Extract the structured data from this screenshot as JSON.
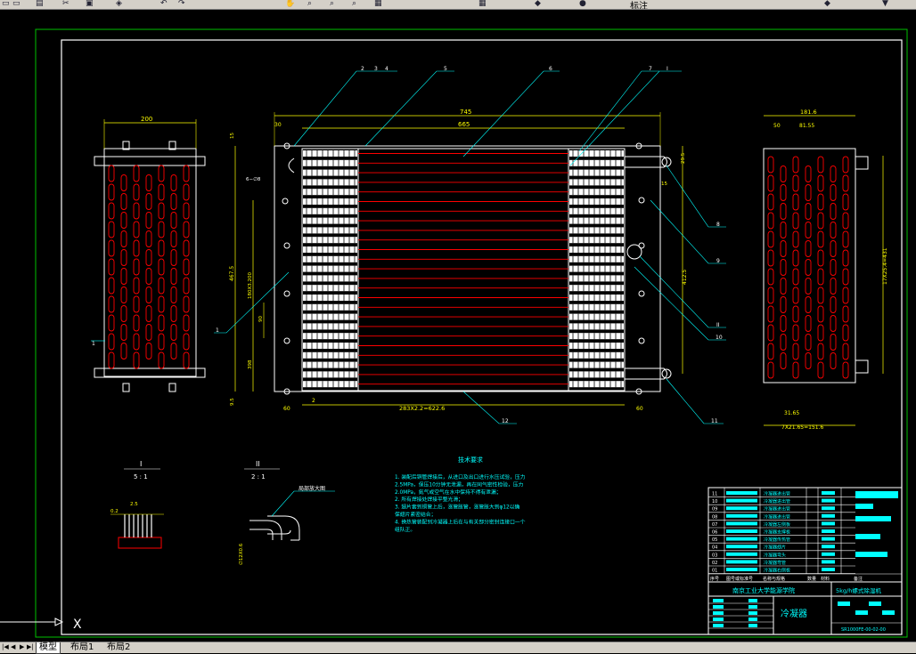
{
  "toolbar": {
    "layer_name": "标注"
  },
  "drawing": {
    "part_labels": [
      "2",
      "3",
      "4",
      "5",
      "6",
      "7",
      "I",
      "8",
      "9",
      "II",
      "10",
      "11",
      "12",
      "1",
      "1"
    ],
    "dims": {
      "left_width": "200",
      "overall_length": "745",
      "tube_length": "665",
      "top_offset": "30",
      "right_width": "181.6",
      "right_sub_a": "50",
      "right_sub_b": "81.55",
      "left_height": "467.5",
      "pitch_note": "180X3.200",
      "dim_90": "90",
      "dim_398": "398",
      "dim_60_left": "60",
      "dim_2": "2",
      "dim_60_right": "60",
      "bottom_span": "283X2.2=622.6",
      "right_height_a": "412.5",
      "right_vert": "17X25.4=431",
      "right_side_a": "29.5",
      "right_15": "15",
      "bottom_side": "31.65",
      "bottom_right": "7X21.65=151.6",
      "left_top_15": "15",
      "left_bottom_95": "9.5",
      "hole_note": "6−∅8"
    },
    "detail_I": {
      "title": "I",
      "scale": "5 : 1",
      "dim_a": "0.2",
      "dim_b": "2.5"
    },
    "detail_II": {
      "title": "II",
      "scale": "2 : 1",
      "label": "局部放大图",
      "dim": "∅12X0.6"
    },
    "tech_req": {
      "title": "技术要求",
      "lines": [
        "1.   装配后铜管焊接后，从进口及出口进行水压试验，压力",
        "   2.5MPa，保压10分钟无泄漏，再在同气密性检验，压力",
        "   2.0MPa，氮气或空气在水中保持不得有泄漏；",
        "2.   所有焊接处焊接平整光滑；",
        "3.   翅片套到铜管上后，涨管胀管，涨管胀大到φ12以确",
        "   保翅片紧密结合；",
        "4.   换热管装配到冷凝器上后在与有关部分密封连接口一个",
        "   组队正。"
      ]
    },
    "title_block": {
      "school": "南京工业大学能源学院",
      "product": "5kg/h螺式除湿机",
      "name": "冷凝器",
      "drawing_no": "SR1000FE-00-02-00",
      "header_cols": [
        "序号",
        "图号或标准号",
        "名称与规格",
        "数量",
        "材料",
        "备注"
      ]
    },
    "bom_rows": [
      {
        "no": "11",
        "spec": "冷凝器进出管"
      },
      {
        "no": "10",
        "spec": "冷凝器进出管"
      },
      {
        "no": "09",
        "spec": "冷凝器进出管"
      },
      {
        "no": "08",
        "spec": "冷凝器进出管"
      },
      {
        "no": "07",
        "spec": "冷凝器左侧板"
      },
      {
        "no": "06",
        "spec": "冷凝器支撑板"
      },
      {
        "no": "05",
        "spec": "冷凝器传热管"
      },
      {
        "no": "04",
        "spec": "冷凝器翅片"
      },
      {
        "no": "03",
        "spec": "冷凝器弯头"
      },
      {
        "no": "02",
        "spec": "冷凝器弯管"
      },
      {
        "no": "01",
        "spec": "冷凝器右侧板"
      }
    ]
  },
  "ucs": {
    "label": "X"
  },
  "tabs": [
    "模型",
    "布局1",
    "布局2"
  ],
  "colors": {
    "background": "#000000",
    "white_line": "#ffffff",
    "red_line": "#ff0000",
    "dim_yellow": "#ffff00",
    "cyan": "#00ffff",
    "green_border": "#00c000"
  }
}
